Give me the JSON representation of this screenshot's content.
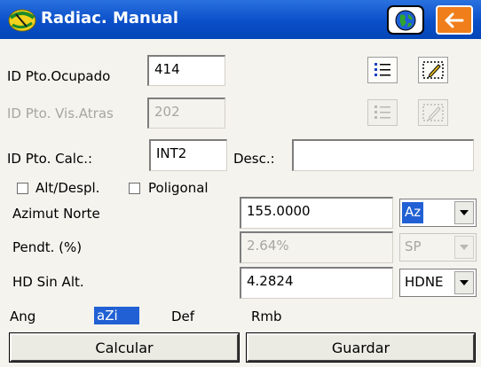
{
  "title": "Radiac. Manual",
  "icons": {
    "app_logo": "surveying-logo",
    "globe": "globe-icon",
    "back": "arrow-left-icon",
    "list": "list-icon",
    "edit": "edit-points-icon"
  },
  "colors": {
    "titlebar": "#0a4fc8",
    "back_button": "#f07e1a",
    "selection": "#2160d4"
  },
  "fields": {
    "occupied": {
      "label": "ID Pto.Ocupado",
      "value": "414"
    },
    "backsight": {
      "label": "ID Pto. Vis.Atras",
      "value": "202"
    },
    "calc": {
      "label": "ID Pto. Calc.:",
      "value": "INT2"
    },
    "desc": {
      "label": "Desc.:",
      "value": ""
    }
  },
  "checkboxes": {
    "alt_despl": {
      "label": "Alt/Despl.",
      "checked": false
    },
    "poligonal": {
      "label": "Poligonal",
      "checked": false
    }
  },
  "measurements": {
    "azimuth": {
      "label": "Azimut Norte",
      "value": "155.0000",
      "unit": "Az"
    },
    "slope": {
      "label": "Pendt. (%)",
      "value": "2.64%",
      "unit": "SP"
    },
    "hd": {
      "label": "HD Sin Alt.",
      "value": "4.2824",
      "unit": "HDNE"
    }
  },
  "modes": [
    "Ang",
    "aZi",
    "Def",
    "Rmb"
  ],
  "active_mode": "aZi",
  "buttons": {
    "calcular": "Calcular",
    "guardar": "Guardar"
  }
}
